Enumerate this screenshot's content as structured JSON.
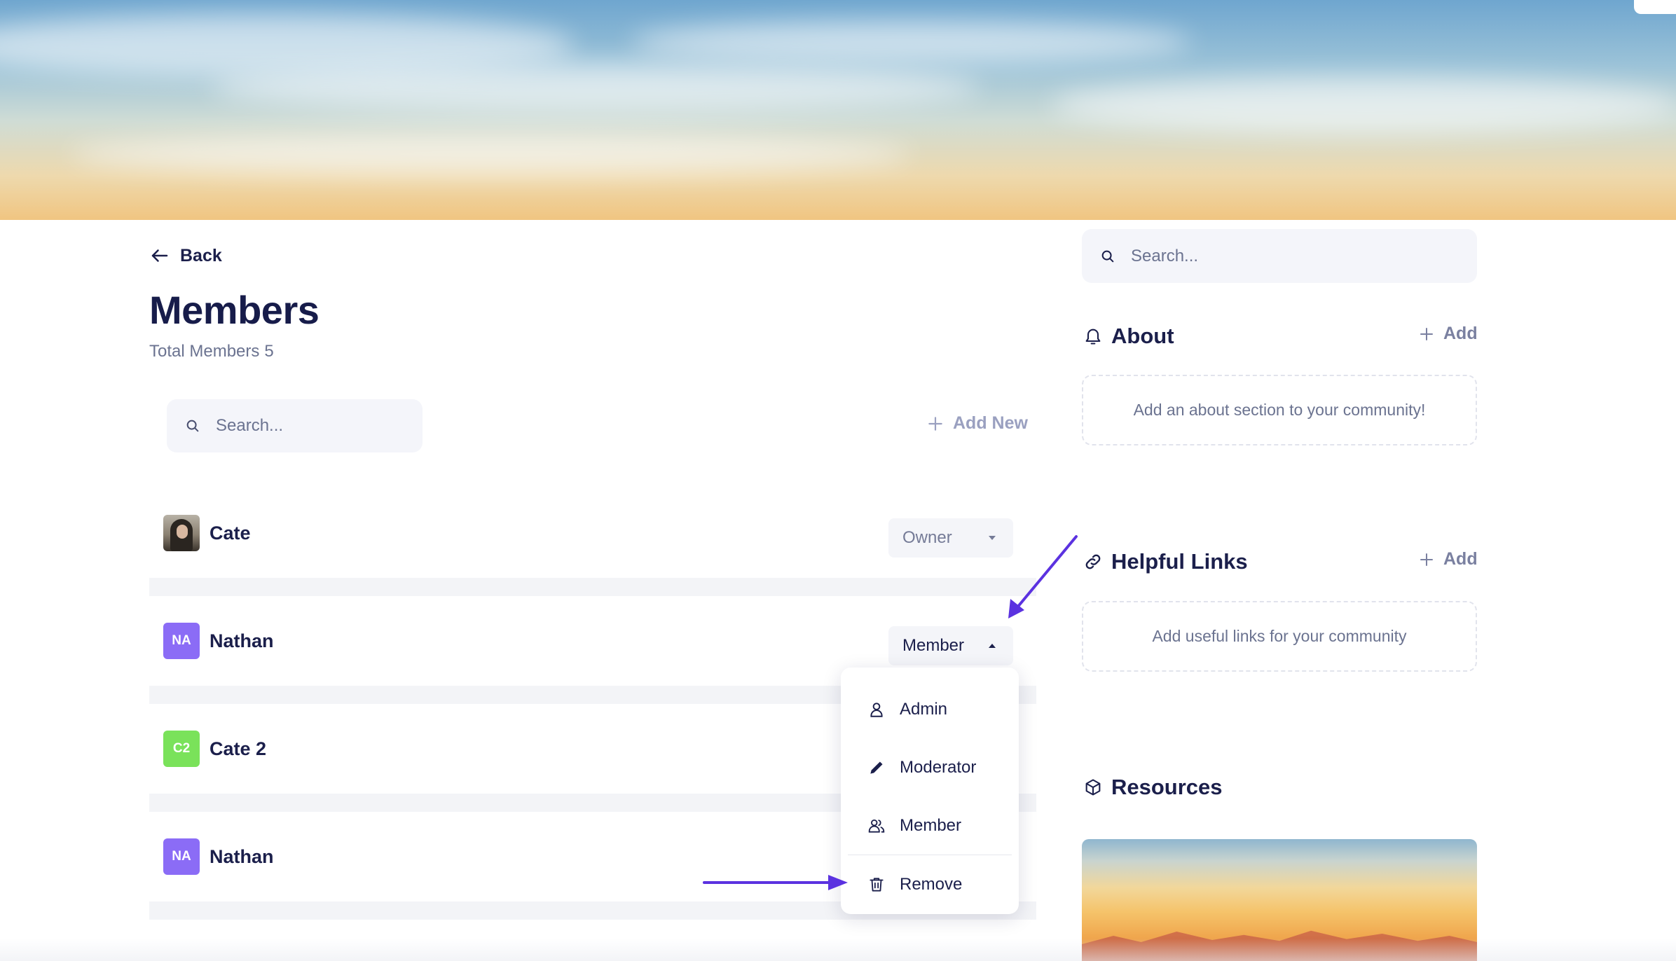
{
  "nav": {
    "back_label": "Back"
  },
  "page": {
    "title": "Members",
    "subtitle_label": "Total Members",
    "member_count": "5"
  },
  "members_search": {
    "placeholder": "Search..."
  },
  "add_new_label": "Add New",
  "members": [
    {
      "name": "Cate",
      "avatar": "photo",
      "initials": "",
      "avatar_color": "",
      "role": "Owner"
    },
    {
      "name": "Nathan",
      "avatar": "initials",
      "initials": "NA",
      "avatar_color": "#8b6cf6",
      "role": "Member"
    },
    {
      "name": "Cate 2",
      "avatar": "initials",
      "initials": "C2",
      "avatar_color": "#7ae25a",
      "role": ""
    },
    {
      "name": "Nathan",
      "avatar": "initials",
      "initials": "NA",
      "avatar_color": "#8b6cf6",
      "role": ""
    }
  ],
  "role_menu": {
    "items": [
      {
        "label": "Admin",
        "icon": "person-icon"
      },
      {
        "label": "Moderator",
        "icon": "pencil-icon"
      },
      {
        "label": "Member",
        "icon": "users-icon"
      },
      {
        "label": "Remove",
        "icon": "trash-icon"
      }
    ]
  },
  "sidebar": {
    "search_placeholder": "Search...",
    "about": {
      "title": "About",
      "add_label": "Add",
      "placeholder": "Add an about section to your community!"
    },
    "helpful_links": {
      "title": "Helpful Links",
      "add_label": "Add",
      "placeholder": "Add useful links for your community"
    },
    "resources": {
      "title": "Resources"
    }
  },
  "colors": {
    "accent_arrow": "#5b32e0",
    "text_primary": "#1b1f4b",
    "text_muted": "#6b7390"
  }
}
